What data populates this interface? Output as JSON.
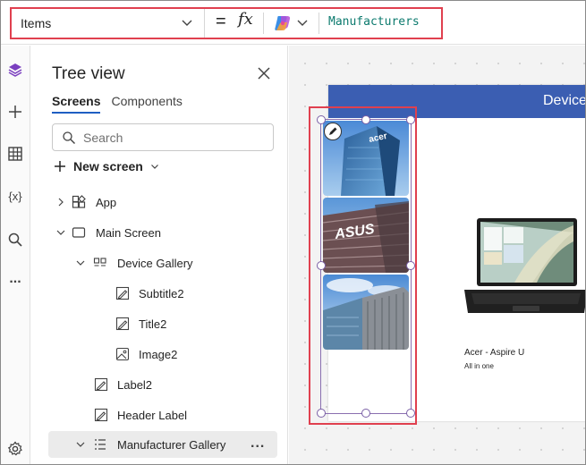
{
  "formula_bar": {
    "property": "Items",
    "equals": "=",
    "fx": "fx",
    "formula": "Manufacturers"
  },
  "rail": {
    "icons": [
      "layers-icon",
      "plus-icon",
      "table-icon",
      "variables-icon",
      "search-icon",
      "more-icon",
      "settings-icon"
    ],
    "variables_glyph": "{x}",
    "more_glyph": "..."
  },
  "tree_view": {
    "title": "Tree view",
    "tabs": [
      {
        "label": "Screens",
        "active": true
      },
      {
        "label": "Components",
        "active": false
      }
    ],
    "search_placeholder": "Search",
    "new_screen_label": "New screen",
    "items": [
      {
        "label": "App",
        "icon": "app-icon",
        "expander": "collapsed"
      },
      {
        "label": "Main Screen",
        "icon": "screen-icon",
        "expander": "expanded"
      },
      {
        "label": "Device Gallery",
        "icon": "gallery-icon",
        "expander": "expanded"
      },
      {
        "label": "Subtitle2",
        "icon": "label-icon",
        "expander": "none"
      },
      {
        "label": "Title2",
        "icon": "label-icon",
        "expander": "none"
      },
      {
        "label": "Image2",
        "icon": "image-icon",
        "expander": "none"
      },
      {
        "label": "Label2",
        "icon": "label-icon",
        "expander": "none"
      },
      {
        "label": "Header Label",
        "icon": "label-icon",
        "expander": "none"
      },
      {
        "label": "Manufacturer Gallery",
        "icon": "gallery-list-icon",
        "expander": "expanded",
        "selected": true
      }
    ],
    "more_glyph": "..."
  },
  "canvas": {
    "header_text": "Device",
    "device_item": {
      "name": "Acer - Aspire U",
      "subtitle": "All in one"
    },
    "manufacturer_images": [
      "acer-building-image",
      "asus-building-image",
      "glass-office-building-image"
    ],
    "colors": {
      "header": "#3b5eb2",
      "highlight": "#e0404f",
      "formula_text": "#0c7a6e",
      "selection": "#8a6fb0"
    }
  }
}
